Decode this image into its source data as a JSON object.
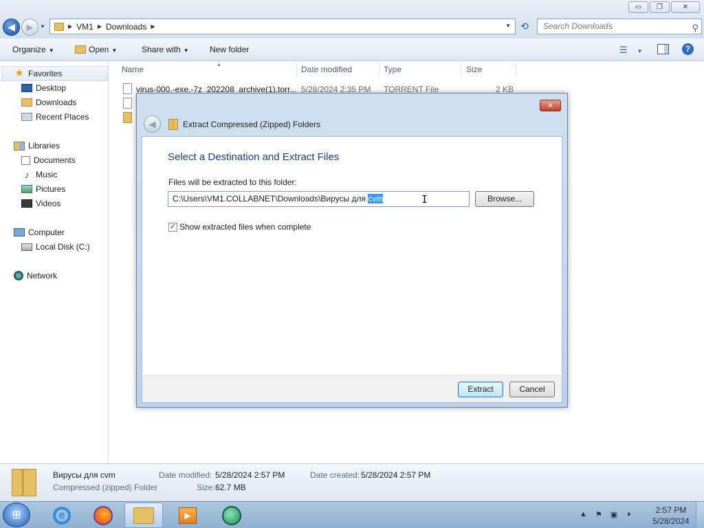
{
  "window": {
    "breadcrumb": [
      "VM1",
      "Downloads"
    ],
    "search_placeholder": "Search Downloads",
    "minimize_glyph": "▭",
    "maximize_glyph": "❐",
    "close_glyph": "✕"
  },
  "toolbar": {
    "organize": "Organize",
    "open": "Open",
    "share_with": "Share with",
    "new_folder": "New folder"
  },
  "sidebar": {
    "favorites": "Favorites",
    "desktop": "Desktop",
    "downloads": "Downloads",
    "recent_places": "Recent Places",
    "libraries": "Libraries",
    "documents": "Documents",
    "music": "Music",
    "pictures": "Pictures",
    "videos": "Videos",
    "computer": "Computer",
    "local_disk": "Local Disk (C:)",
    "network": "Network"
  },
  "filelist": {
    "columns": [
      "Name",
      "Date modified",
      "Type",
      "Size"
    ],
    "rows": [
      {
        "name": "virus-000.-exe.-7z_202208_archive(1).torr...",
        "date": "5/28/2024 2:35 PM",
        "type": "TORRENT File",
        "size": "2 KB"
      }
    ]
  },
  "details": {
    "name": "Вирусы для cvm",
    "kind": "Compressed (zipped) Folder",
    "date_modified_label": "Date modified:",
    "date_modified": "5/28/2024 2:57 PM",
    "date_created_label": "Date created:",
    "date_created": "5/28/2024 2:57 PM",
    "size_label": "Size:",
    "size": "62.7 MB"
  },
  "dialog": {
    "title": "Extract Compressed (Zipped) Folders",
    "heading": "Select a Destination and Extract Files",
    "destination_label": "Files will be extracted to this folder:",
    "path_prefix": "C:\\Users\\VM1.COLLABNET\\Downloads\\Вирусы для ",
    "path_selected": "cvm",
    "browse": "Browse...",
    "show_files_label": "Show extracted files when complete",
    "show_files_checked": true,
    "extract": "Extract",
    "cancel": "Cancel"
  },
  "taskbar": {
    "time": "2:57 PM",
    "date": "5/28/2024"
  }
}
